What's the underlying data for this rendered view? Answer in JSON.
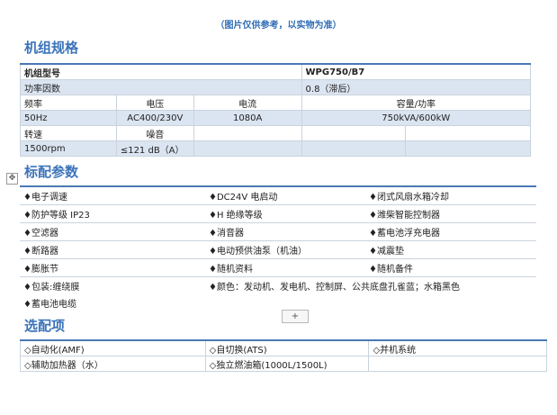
{
  "note": "（图片仅供参考，以实物为准）",
  "sections": {
    "spec_title": "机组规格",
    "features_title": "标配参数",
    "options_title": "选配项"
  },
  "spec": {
    "model_label": "机组型号",
    "model_value": "WPG750/B7",
    "pf_label": "功率因数",
    "pf_value": "0.8（滞后）",
    "h_freq": "频率",
    "h_voltage": "电压",
    "h_current": "电流",
    "h_capacity": "容量/功率",
    "freq": "50Hz",
    "voltage": "AC400/230V",
    "current": "1080A",
    "capacity": "750kVA/600kW",
    "h_speed": "转速",
    "h_noise": "噪音",
    "speed": "1500rpm",
    "noise": "≤121 dB（A）"
  },
  "features": [
    [
      "♦电子调速",
      "♦DC24V 电启动",
      "♦闭式风扇水箱冷却"
    ],
    [
      "♦防护等级 IP23",
      "♦H 绝缘等级",
      "♦潍柴智能控制器"
    ],
    [
      "♦空滤器",
      "♦消音器",
      "♦蓄电池浮充电器"
    ],
    [
      "♦断路器",
      "♦电动预供油泵（机油）",
      "♦减震垫"
    ],
    [
      "♦膨胀节",
      "♦随机资料",
      "♦随机备件"
    ]
  ],
  "features_row6": {
    "a": "♦包装:缠绕膜",
    "b": "♦颜色：发动机、发电机、控制屏、公共底盘孔雀蓝；水箱黑色"
  },
  "features_row7": "♦蓄电池电缆",
  "options": [
    [
      "◇自动化(AMF)",
      "◇自切换(ATS)",
      "◇并机系统"
    ],
    [
      "◇辅助加热器（水）",
      "◇独立燃油箱(1000L/1500L)",
      ""
    ]
  ],
  "icons": {
    "move": "move-icon",
    "add": "plus-icon"
  },
  "colors": {
    "heading": "#3b73b9",
    "rule": "#4a78b5",
    "band": "#dbe5f2"
  }
}
